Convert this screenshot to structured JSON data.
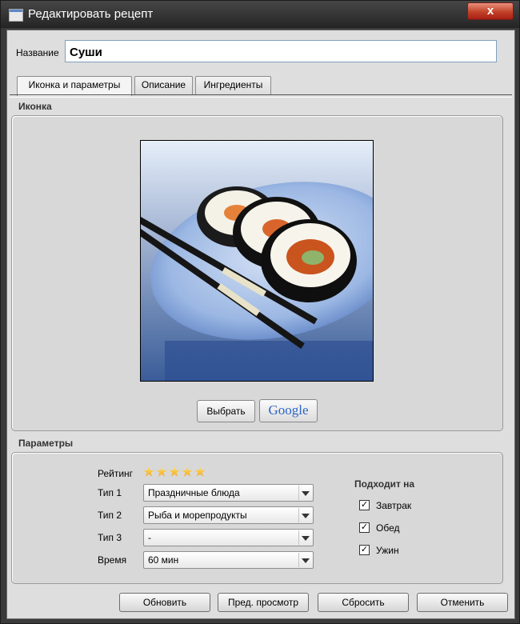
{
  "window": {
    "title": "Редактировать рецепт",
    "close_glyph": "x",
    "icon": "window-icon"
  },
  "name_field": {
    "label": "Название",
    "value": "Суши"
  },
  "tabs": [
    {
      "label": "Иконка и параметры",
      "active": true
    },
    {
      "label": "Описание",
      "active": false
    },
    {
      "label": "Ингредиенты",
      "active": false
    }
  ],
  "icon_section": {
    "title": "Иконка",
    "choose_button": "Выбрать",
    "google_button": "Google"
  },
  "params_section": {
    "title": "Параметры",
    "rating": {
      "label": "Рейтинг",
      "stars": 5,
      "max": 5
    },
    "type1": {
      "label": "Тип 1",
      "value": "Праздничные блюда"
    },
    "type2": {
      "label": "Тип 2",
      "value": "Рыба и морепродукты"
    },
    "type3": {
      "label": "Тип 3",
      "value": "-"
    },
    "time": {
      "label": "Время",
      "value": "60 мин"
    },
    "suits_for": {
      "title": "Подходит на",
      "items": [
        {
          "label": "Завтрак",
          "checked": true
        },
        {
          "label": "Обед",
          "checked": true
        },
        {
          "label": "Ужин",
          "checked": true
        }
      ]
    }
  },
  "footer": {
    "update": "Обновить",
    "preview": "Пред. просмотр",
    "reset": "Сбросить",
    "cancel": "Отменить"
  }
}
